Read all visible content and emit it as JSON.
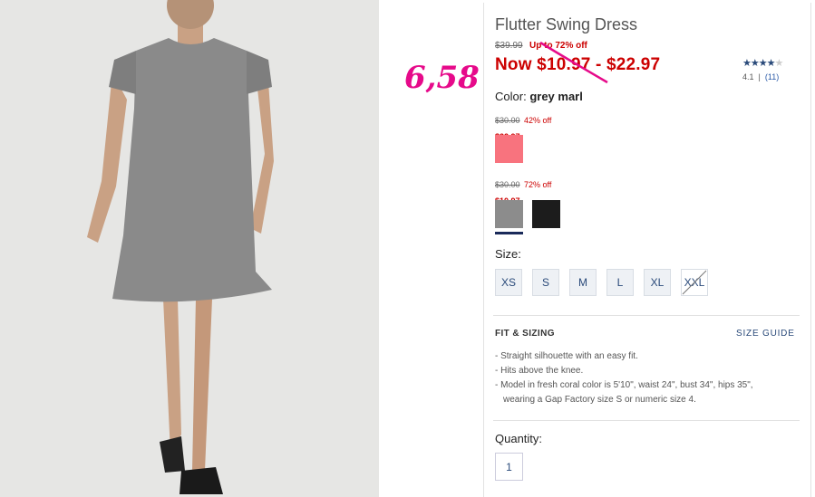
{
  "product": {
    "title": "Flutter Swing Dress",
    "original_price": "$39.99",
    "discount_text": "Up to 72% off",
    "now_price": "Now $10.97 - $22.97"
  },
  "annotation": {
    "handwritten_price": "6,58"
  },
  "rating": {
    "stars_filled": 4,
    "stars_total": 5,
    "value": "4.1",
    "separator": "|",
    "count": "(11)"
  },
  "color": {
    "label": "Color:",
    "selected_name": "grey marl",
    "groups": [
      {
        "original": "$30.00",
        "off": "42% off",
        "sale": "$22.97",
        "swatches": [
          {
            "name": "fresh coral",
            "hex": "#f8737e"
          }
        ]
      },
      {
        "original": "$30.00",
        "off": "72% off",
        "sale": "$10.97",
        "swatches": [
          {
            "name": "grey marl",
            "hex": "#8c8c8c",
            "selected": true
          },
          {
            "name": "black",
            "hex": "#1c1c1c"
          }
        ]
      }
    ]
  },
  "size": {
    "label": "Size:",
    "options": [
      "XS",
      "S",
      "M",
      "L",
      "XL",
      "XXL"
    ],
    "unavailable": [
      "XXL"
    ]
  },
  "fit": {
    "heading": "FIT & SIZING",
    "guide_link": "SIZE GUIDE",
    "bullets": [
      "Straight silhouette with an easy fit.",
      "Hits above the knee.",
      "Model in fresh coral color is 5'10\", waist 24\", bust 34\", hips 35\",",
      "wearing a Gap Factory size S or numeric size 4."
    ]
  },
  "quantity": {
    "label": "Quantity:",
    "value": "1"
  },
  "colors": {
    "sale_red": "#cc0000",
    "link_blue": "#2a4a7a",
    "annotation_pink": "#e60a8a",
    "selected_underline": "#1a2a5a"
  }
}
